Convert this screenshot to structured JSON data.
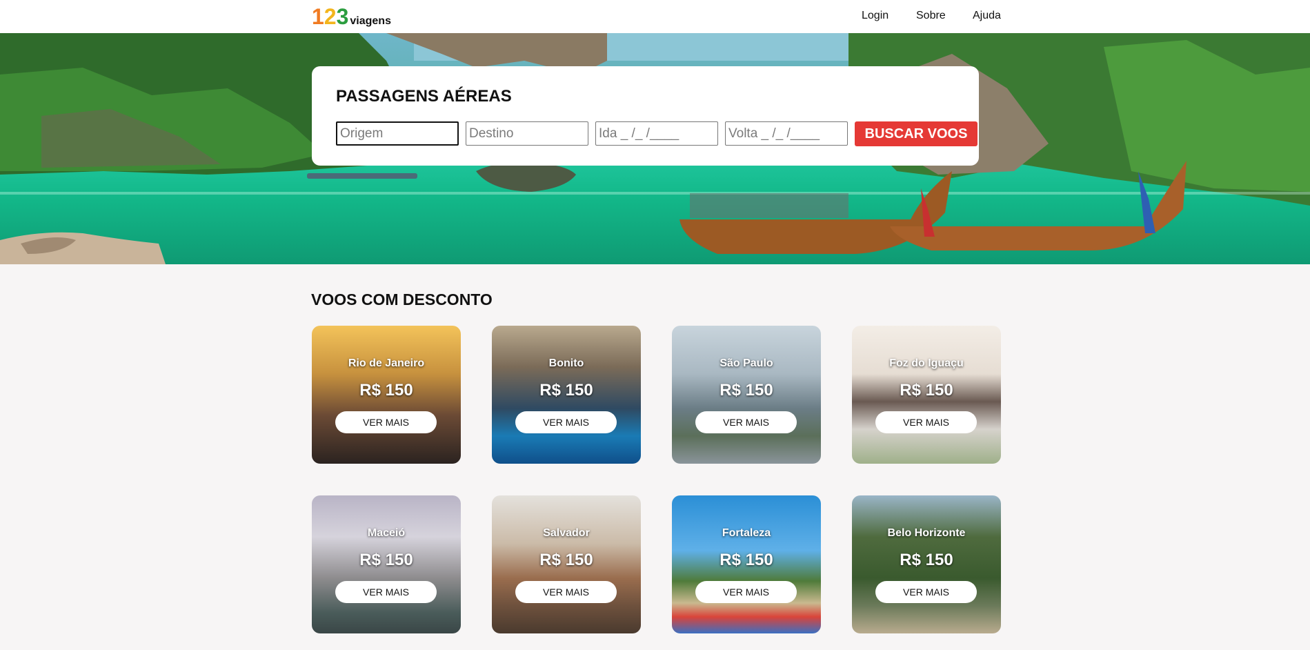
{
  "header": {
    "logo_digits": [
      "1",
      "2",
      "3"
    ],
    "logo_word": "viagens",
    "nav": [
      "Login",
      "Sobre",
      "Ajuda"
    ]
  },
  "search": {
    "title": "PASSAGENS AÉREAS",
    "origin_placeholder": "Origem",
    "destination_placeholder": "Destino",
    "departure_placeholder": "Ida _ /_ /____",
    "return_placeholder": "Volta _ /_ /____",
    "button_label": "BUSCAR VOOS"
  },
  "discounts": {
    "title": "VOOS COM DESCONTO",
    "cards": [
      {
        "city": "Rio de Janeiro",
        "price": "R$ 150",
        "button": "VER MAIS"
      },
      {
        "city": "Bonito",
        "price": "R$ 150",
        "button": "VER MAIS"
      },
      {
        "city": "São Paulo",
        "price": "R$ 150",
        "button": "VER MAIS"
      },
      {
        "city": "Foz do Iguaçu",
        "price": "R$ 150",
        "button": "VER MAIS"
      },
      {
        "city": "Maceió",
        "price": "R$ 150",
        "button": "VER MAIS"
      },
      {
        "city": "Salvador",
        "price": "R$ 150",
        "button": "VER MAIS"
      },
      {
        "city": "Fortaleza",
        "price": "R$ 150",
        "button": "VER MAIS"
      },
      {
        "city": "Belo Horizonte",
        "price": "R$ 150",
        "button": "VER MAIS"
      }
    ]
  },
  "colors": {
    "search_button": "#e53935",
    "logo_1": "#f07b22",
    "logo_2": "#f3b51c",
    "logo_3": "#2b9d3f"
  }
}
